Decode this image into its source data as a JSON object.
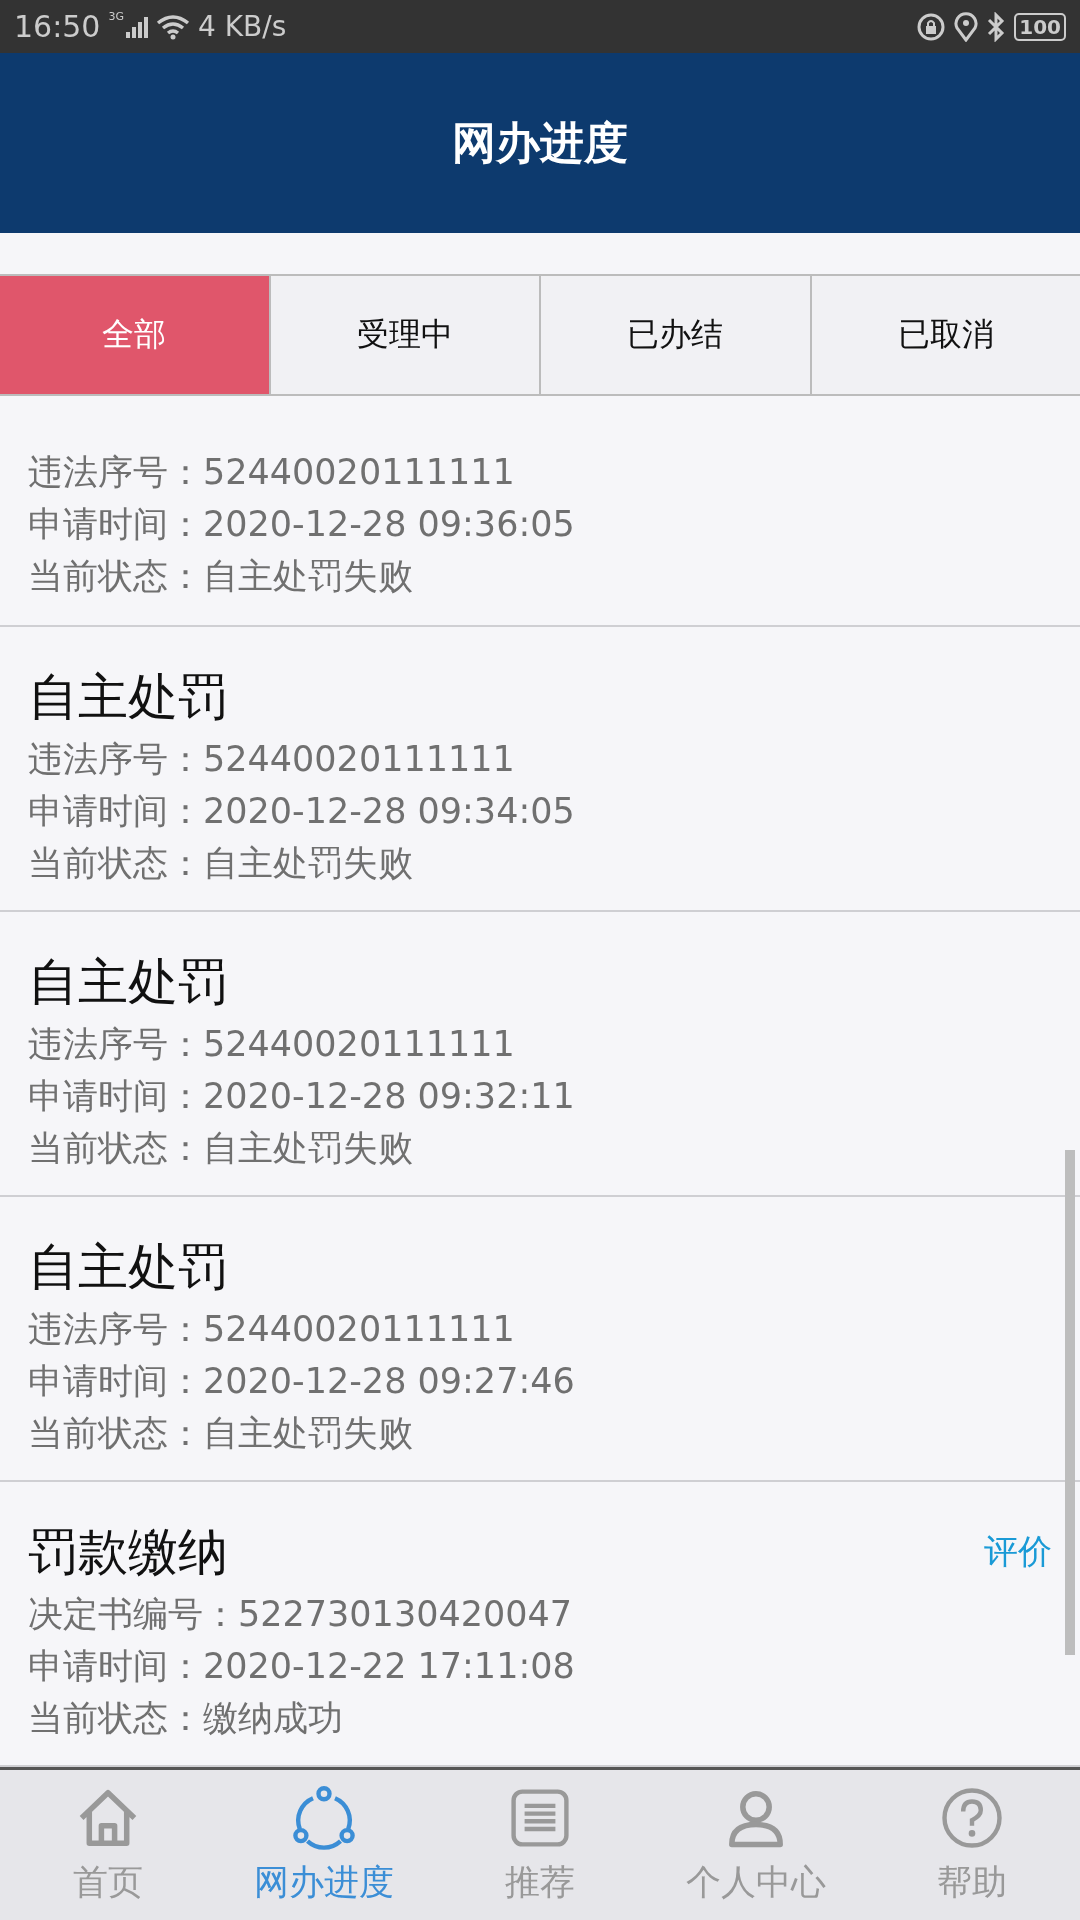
{
  "status_bar": {
    "time": "16:50",
    "network": "3G",
    "speed": "4 KB/s",
    "battery": "100"
  },
  "header": {
    "title": "网办进度"
  },
  "tabs": [
    {
      "label": "全部",
      "selected": true
    },
    {
      "label": "受理中",
      "selected": false
    },
    {
      "label": "已办结",
      "selected": false
    },
    {
      "label": "已取消",
      "selected": false
    }
  ],
  "records": [
    {
      "lines": [
        "违法序号：52440020111111",
        "申请时间：2020-12-28 09:36:05",
        "当前状态：自主处罚失败"
      ]
    },
    {
      "title": "自主处罚",
      "lines": [
        "违法序号：52440020111111",
        "申请时间：2020-12-28 09:34:05",
        "当前状态：自主处罚失败"
      ]
    },
    {
      "title": "自主处罚",
      "lines": [
        "违法序号：52440020111111",
        "申请时间：2020-12-28 09:32:11",
        "当前状态：自主处罚失败"
      ]
    },
    {
      "title": "自主处罚",
      "lines": [
        "违法序号：52440020111111",
        "申请时间：2020-12-28 09:27:46",
        "当前状态：自主处罚失败"
      ]
    },
    {
      "title": "罚款缴纳",
      "action": "评价",
      "lines": [
        "决定书编号：522730130420047",
        "申请时间：2020-12-22 17:11:08",
        "当前状态：缴纳成功"
      ]
    }
  ],
  "nav": [
    {
      "label": "首页",
      "selected": false
    },
    {
      "label": "网办进度",
      "selected": true
    },
    {
      "label": "推荐",
      "selected": false
    },
    {
      "label": "个人中心",
      "selected": false
    },
    {
      "label": "帮助",
      "selected": false
    }
  ]
}
